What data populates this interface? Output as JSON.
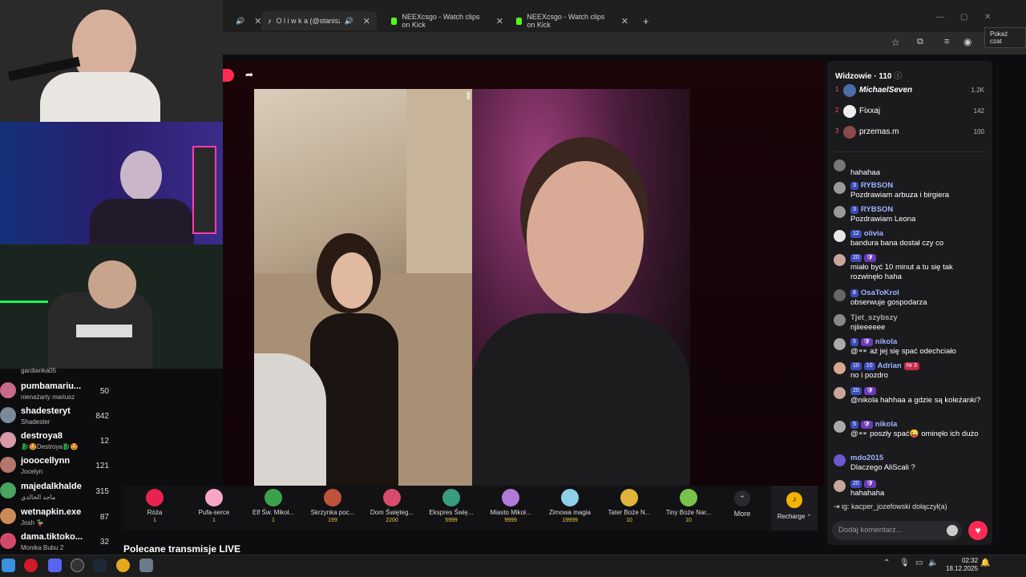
{
  "browser": {
    "tabs": [
      {
        "label": "O l i w k a (@staniszesia_) o",
        "active": true
      },
      {
        "label": "NEEXcsgo - Watch clips on Kick"
      },
      {
        "label": "NEEXcsgo - Watch clips on Kick"
      }
    ],
    "new_tab": "+",
    "tooltip": "Pokaż czat"
  },
  "left_list": [
    {
      "name": "",
      "sub": "gardianka05",
      "count": ""
    },
    {
      "name": "pumbamariu...",
      "sub": "nienażarty mariusz",
      "count": "50"
    },
    {
      "name": "shadesteryt",
      "sub": "Shadester",
      "count": "842"
    },
    {
      "name": "destroya8",
      "sub": "🐉🤩Destroya🐉🤩",
      "count": "12"
    },
    {
      "name": "jooocellynn",
      "sub": "Jocelyn",
      "count": "121"
    },
    {
      "name": "majedalkhalde",
      "sub": "ماجد الخالدي",
      "count": "315"
    },
    {
      "name": "wetnapkin.exe",
      "sub": "Josh 🦆",
      "count": "87"
    },
    {
      "name": "dama.tiktoko...",
      "sub": "Monika Bubu 2",
      "count": "32"
    }
  ],
  "recommended_title": "Polecane transmisje LIVE",
  "gifts": [
    {
      "name": "Róża",
      "price": "1",
      "color": "#e8234e"
    },
    {
      "name": "Pufa-serce",
      "price": "1",
      "color": "#f6a6c9"
    },
    {
      "name": "Elf Św. Mikoł...",
      "price": "1",
      "color": "#3aa24b"
    },
    {
      "name": "Skrzynka poc...",
      "price": "199",
      "color": "#c0533a"
    },
    {
      "name": "Dom Święteg...",
      "price": "2200",
      "color": "#d94b6b"
    },
    {
      "name": "Ekspres Świę...",
      "price": "5999",
      "color": "#3a9c7e"
    },
    {
      "name": "Miasto Mikoł...",
      "price": "9999",
      "color": "#b07ad8"
    },
    {
      "name": "Zimowa magia",
      "price": "19999",
      "color": "#8fd0e8"
    },
    {
      "name": "Tater Boże N...",
      "price": "10",
      "color": "#e0b43a"
    },
    {
      "name": "Tiny Boże Nar...",
      "price": "10",
      "color": "#7ac34a"
    }
  ],
  "more_label": "More",
  "recharge_label": "Recharge",
  "viewers": {
    "title": "Widzowie · 110",
    "top": [
      {
        "rank": "1",
        "name": "MichaelSeven",
        "count": "1.2K"
      },
      {
        "rank": "2",
        "name": "Fixxaj",
        "count": "142"
      },
      {
        "rank": "3",
        "name": "przemas.m",
        "count": "100"
      }
    ]
  },
  "chat": [
    {
      "badges": [],
      "user": "",
      "text": "hahahaa"
    },
    {
      "badges": [
        "3"
      ],
      "user": "RYBSON",
      "text": "Pozdrawiam arbuza i birgiera"
    },
    {
      "badges": [
        "3"
      ],
      "user": "RYBSON",
      "text": "Pozdrawiam Leona"
    },
    {
      "badges": [
        "12"
      ],
      "user": "olivia",
      "text": "bandura bana dostał czy co"
    },
    {
      "badges": [
        "20",
        "🛡"
      ],
      "user": "",
      "text": "miało być 10 minut a tu się tak rozwinęło haha"
    },
    {
      "badges": [
        "8"
      ],
      "user": "OsaToKrol",
      "text": "obserwuje gospodarza"
    },
    {
      "badges": [],
      "user": "Tjet_szybszy",
      "text": "njiieeeeee"
    },
    {
      "badges": [
        "5",
        "🛡"
      ],
      "user": "nikola",
      "text": "@👓 aż jej się spać odechciało"
    },
    {
      "badges": [
        "10",
        "10"
      ],
      "user": "Adrian",
      "extra": "Nr 3",
      "text": "no i pozdro"
    },
    {
      "badges": [
        "20",
        "🛡"
      ],
      "user": "",
      "text": "@nikola hahhaa a gdzie są koleżanki?"
    },
    {
      "badges": [
        "5",
        "🛡"
      ],
      "user": "nikola",
      "text": "@👓 poszły spać😜 ominęło ich dużo"
    },
    {
      "badges": [],
      "user": "mdo2015",
      "text": "Dlaczego AliScali ?"
    },
    {
      "badges": [
        "20",
        "🛡"
      ],
      "user": "",
      "text": "hahahaha"
    }
  ],
  "join_text": "ig: kacper_jozefowski dołączył(a)",
  "comment_placeholder": "Dodaj komentarz...",
  "clock": {
    "time": "02:32",
    "date": "18.12.2025"
  }
}
